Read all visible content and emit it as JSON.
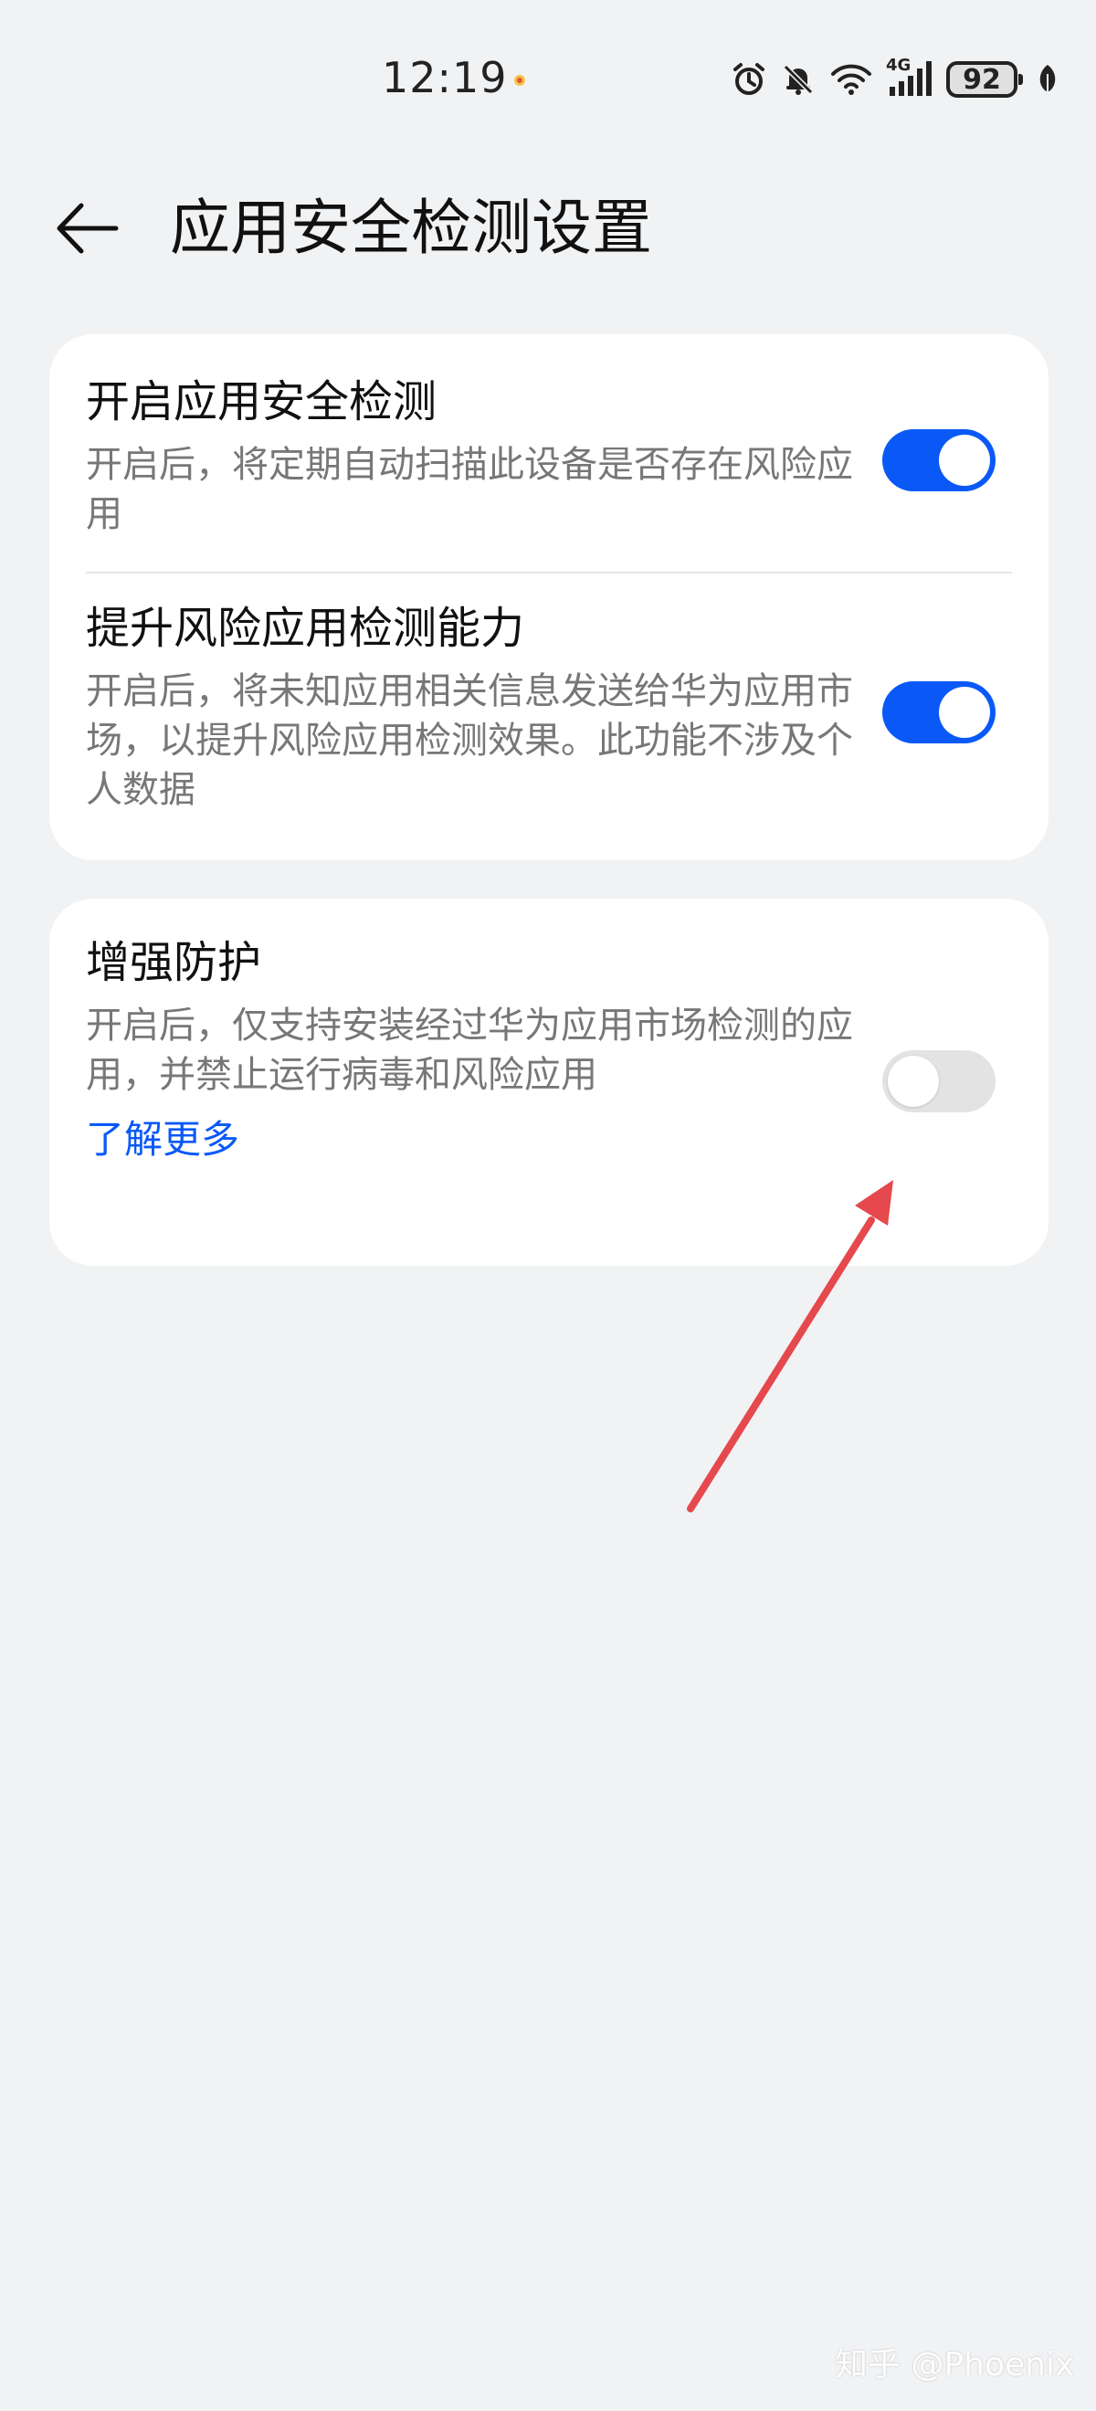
{
  "status_bar": {
    "time": "12:19",
    "network": "4G",
    "battery": "92"
  },
  "header": {
    "title": "应用安全检测设置"
  },
  "settings": {
    "app_security_scan": {
      "title": "开启应用安全检测",
      "description": "开启后，将定期自动扫描此设备是否存在风险应用",
      "enabled": true
    },
    "enhanced_detection": {
      "title": "提升风险应用检测能力",
      "description": "开启后，将未知应用相关信息发送给华为应用市场，以提升风险应用检测效果。此功能不涉及个人数据",
      "enabled": true
    },
    "enhanced_protection": {
      "title": "增强防护",
      "description": "开启后，仅支持安装经过华为应用市场检测的应用，并禁止运行病毒和风险应用",
      "enabled": false,
      "link": "了解更多"
    }
  },
  "colors": {
    "accent": "#0a59f7",
    "background": "#f1f2f4",
    "card": "#ffffff",
    "annotation": "#e5484d"
  },
  "watermark": "知乎 @Phoenix"
}
